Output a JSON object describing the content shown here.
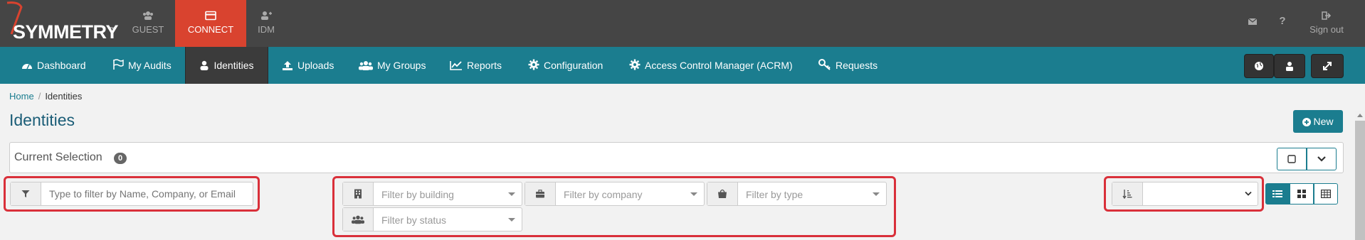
{
  "brand": {
    "name": "SYMMETRY",
    "tm": "™"
  },
  "topnav": {
    "guest": "GUEST",
    "connect": "CONNECT",
    "idm": "IDM",
    "sign_out": "Sign out",
    "help": "?"
  },
  "mainnav": {
    "items": [
      {
        "label": "Dashboard",
        "icon": "dashboard-icon"
      },
      {
        "label": "My Audits",
        "icon": "flag-icon"
      },
      {
        "label": "Identities",
        "icon": "user-icon"
      },
      {
        "label": "Uploads",
        "icon": "upload-icon"
      },
      {
        "label": "My Groups",
        "icon": "group-icon"
      },
      {
        "label": "Reports",
        "icon": "chart-icon"
      },
      {
        "label": "Configuration",
        "icon": "gear-icon"
      },
      {
        "label": "Access Control Manager (ACRM)",
        "icon": "gear-icon"
      },
      {
        "label": "Requests",
        "icon": "key-icon"
      }
    ],
    "active": "Identities"
  },
  "breadcrumb": {
    "home": "Home",
    "current": "Identities"
  },
  "page": {
    "title": "Identities",
    "new_label": "New"
  },
  "current_selection": {
    "label": "Current Selection",
    "count": "0"
  },
  "filters": {
    "search_placeholder": "Type to filter by Name, Company, or Email",
    "building": "Filter by building",
    "company": "Filter by company",
    "type": "Filter by type",
    "status": "Filter by status",
    "sort_value": ""
  },
  "colors": {
    "accent": "#1b7d8f",
    "topbar": "#454545",
    "active": "#d9432f",
    "highlight": "#d9303a"
  }
}
